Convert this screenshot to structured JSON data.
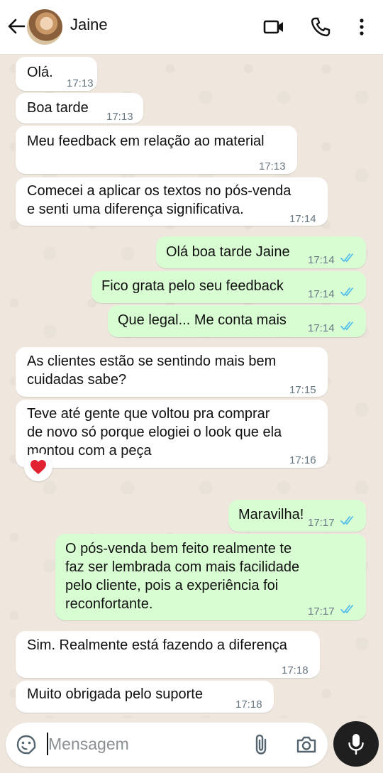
{
  "header": {
    "contact_name": "Jaine",
    "icons": [
      "back-arrow-icon",
      "video-call-icon",
      "phone-call-icon",
      "more-options-icon"
    ]
  },
  "messages": [
    {
      "dir": "in",
      "text": "Olá.",
      "time": "17:13"
    },
    {
      "dir": "in",
      "text": "Boa tarde",
      "time": "17:13"
    },
    {
      "dir": "in",
      "text": "Meu feedback em relação ao material",
      "time": "17:13"
    },
    {
      "dir": "in",
      "text": "Comecei a aplicar os textos no pós-venda\ne senti uma diferença significativa.",
      "time": "17:14"
    },
    {
      "dir": "out",
      "text": "Olá boa tarde Jaine",
      "time": "17:14",
      "status": "read"
    },
    {
      "dir": "out",
      "text": "Fico grata pelo seu feedback",
      "time": "17:14",
      "status": "read"
    },
    {
      "dir": "out",
      "text": "Que legal... Me conta mais",
      "time": "17:14",
      "status": "read"
    },
    {
      "dir": "in",
      "text": "As clientes estão se sentindo mais bem\ncuidadas sabe?",
      "time": "17:15"
    },
    {
      "dir": "in",
      "text": "Teve até gente que voltou pra comprar\nde novo só porque elogiei o look que ela\nmontou com a peça",
      "time": "17:16",
      "reaction": "❤️"
    },
    {
      "dir": "out",
      "text": "Maravilha!",
      "time": "17:17",
      "status": "read"
    },
    {
      "dir": "out",
      "text": "O pós-venda bem feito realmente te\nfaz ser lembrada com mais facilidade\npelo cliente, pois a experiência foi\nreconfortante.",
      "time": "17:17",
      "status": "read"
    },
    {
      "dir": "in",
      "text": "Sim. Realmente está fazendo a diferença",
      "time": "17:18"
    },
    {
      "dir": "in",
      "text": "Muito obrigada pelo suporte",
      "time": "17:18"
    }
  ],
  "composer": {
    "placeholder": "Mensagem",
    "icons": [
      "sticker-icon",
      "attach-icon",
      "camera-icon",
      "mic-icon"
    ]
  },
  "colors": {
    "incoming_bubble": "#ffffff",
    "outgoing_bubble": "#d9fdd3",
    "read_ticks": "#53bdeb",
    "chat_background": "#efe7de"
  }
}
